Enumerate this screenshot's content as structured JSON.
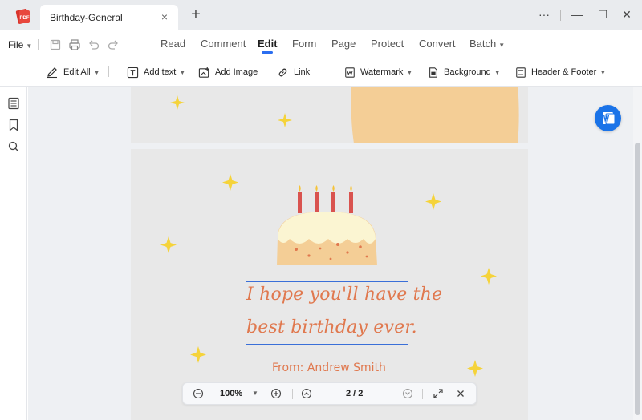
{
  "tab": {
    "title": "Birthday-General",
    "close": "×"
  },
  "titlebar": {
    "new_tab": "+",
    "more": "···",
    "minimize": "—",
    "maximize": "☐",
    "close": "✕"
  },
  "menu": {
    "file": "File",
    "nav": [
      "Read",
      "Comment",
      "Edit",
      "Form",
      "Page",
      "Protect",
      "Convert",
      "Batch"
    ],
    "active": "Edit"
  },
  "toolbar": {
    "edit_all": "Edit All",
    "add_text": "Add text",
    "add_image": "Add Image",
    "link": "Link",
    "watermark": "Watermark",
    "background": "Background",
    "header_footer": "Header & Footer"
  },
  "document": {
    "greeting_line1": "I hope you'll have the",
    "greeting_line2": "best birthday ever.",
    "from": "From: Andrew Smith"
  },
  "zoom": {
    "level": "100%",
    "page": "2 / 2"
  },
  "colors": {
    "accent": "#2b6ef0",
    "greeting": "#e0784e",
    "page_bg": "#e8e8e8",
    "star": "#f5d33a",
    "cake": "#f4ce96",
    "candle": "#d9534f"
  }
}
